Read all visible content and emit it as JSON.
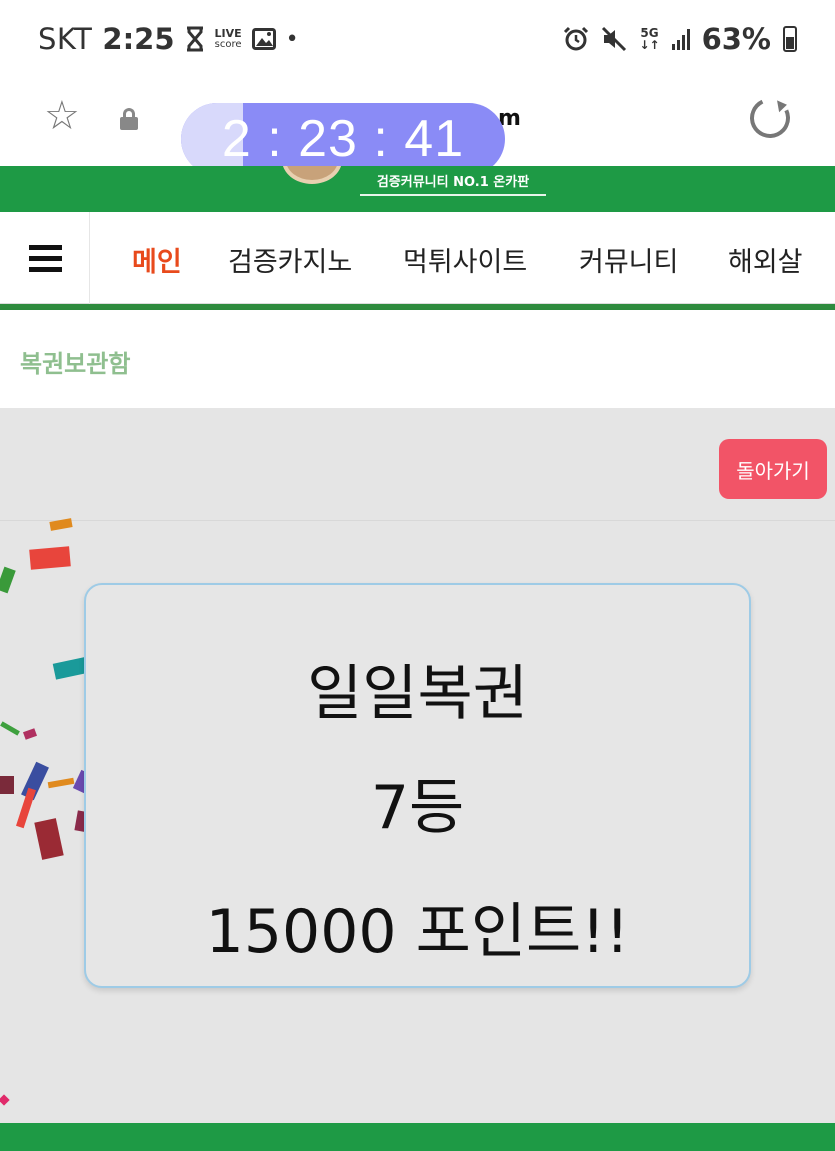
{
  "status_bar": {
    "carrier": "SKT",
    "time": "2:25",
    "live_top": "LIVE",
    "live_bottom": "score",
    "dot": "•",
    "network": "5G",
    "battery": "63%",
    "icons": [
      "hourglass-icon",
      "live-score-icon",
      "gallery-icon",
      "alarm-icon",
      "mute-icon",
      "network-5g-icon",
      "signal-icon",
      "battery-icon"
    ]
  },
  "browser": {
    "url_visible_tail": "m",
    "timer": "2 : 23 : 41",
    "icons": [
      "star-icon",
      "lock-icon",
      "reload-icon"
    ]
  },
  "header": {
    "slogan": "검증커뮤니티 NO.1 온카판"
  },
  "nav": {
    "items": [
      {
        "label": "메인",
        "active": true
      },
      {
        "label": "검증카지노",
        "active": false
      },
      {
        "label": "먹튀사이트",
        "active": false
      },
      {
        "label": "커뮤니티",
        "active": false
      },
      {
        "label": "해외살",
        "active": false
      }
    ]
  },
  "breadcrumb": "복권보관함",
  "back_button": "돌아가기",
  "card": {
    "title": "일일복권",
    "rank": "7등",
    "prize": "15000 포인트!!"
  },
  "colors": {
    "brand_green": "#1e9a45",
    "active_nav": "#e84a1c",
    "back_button": "#f25467",
    "timer": "#8a8bf6"
  }
}
